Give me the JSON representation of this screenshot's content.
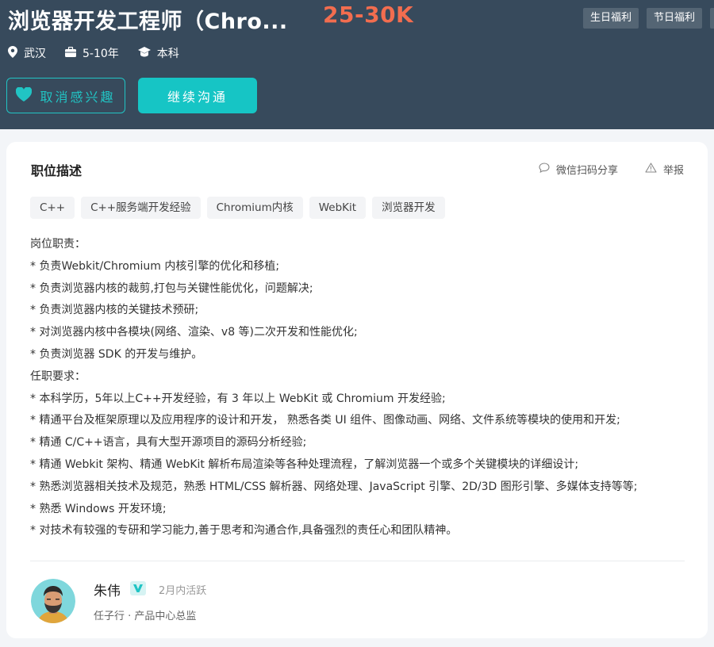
{
  "header": {
    "title": "浏览器开发工程师（Chro...",
    "salary": "25-30K",
    "benefits": [
      "生日福利",
      "节日福利"
    ],
    "location": "武汉",
    "experience": "5-10年",
    "education": "本科",
    "uninterest_label": "取消感兴趣",
    "chat_label": "继续沟通"
  },
  "card": {
    "section_title": "职位描述",
    "share_label": "微信扫码分享",
    "report_label": "举报",
    "tags": [
      "C++",
      "C++服务端开发经验",
      "Chromium内核",
      "WebKit",
      "浏览器开发"
    ],
    "description": [
      "岗位职责：",
      "* 负责Webkit/Chromium 内核引擎的优化和移植;",
      "* 负责浏览器内核的裁剪,打包与关键性能优化，问题解决;",
      "* 负责浏览器内核的关键技术预研;",
      "* 对浏览器内核中各模块(网络、渲染、v8 等)二次开发和性能优化;",
      "* 负责浏览器 SDK 的开发与维护。",
      "任职要求：",
      "* 本科学历，5年以上C++开发经验，有 3 年以上 WebKit 或 Chromium 开发经验;",
      "* 精通平台及框架原理以及应用程序的设计和开发， 熟悉各类 UI 组件、图像动画、网络、文件系统等模块的使用和开发;",
      "* 精通 C/C++语言，具有大型开源项目的源码分析经验;",
      "* 精通 Webkit 架构、精通 WebKit 解析布局渲染等各种处理流程，了解浏览器一个或多个关键模块的详细设计;",
      "* 熟悉浏览器相关技术及规范，熟悉 HTML/CSS 解析器、网络处理、JavaScript 引擎、2D/3D 图形引擎、多媒体支持等等;",
      "* 熟悉 Windows 开发环境;",
      "* 对技术有较强的专研和学习能力,善于思考和沟通合作,具备强烈的责任心和团队精神。"
    ],
    "recruiter": {
      "name": "朱伟",
      "active": "2月内活跃",
      "company_title": "任子行 · 产品中心总监"
    }
  },
  "colors": {
    "header_bg": "#374a5c",
    "accent_teal": "#16c5c5",
    "salary": "#f26d4f"
  },
  "icons": [
    "location-icon",
    "briefcase-icon",
    "graduation-cap-icon",
    "heart-icon",
    "chat-bubble-icon",
    "warning-icon",
    "verified-icon"
  ]
}
